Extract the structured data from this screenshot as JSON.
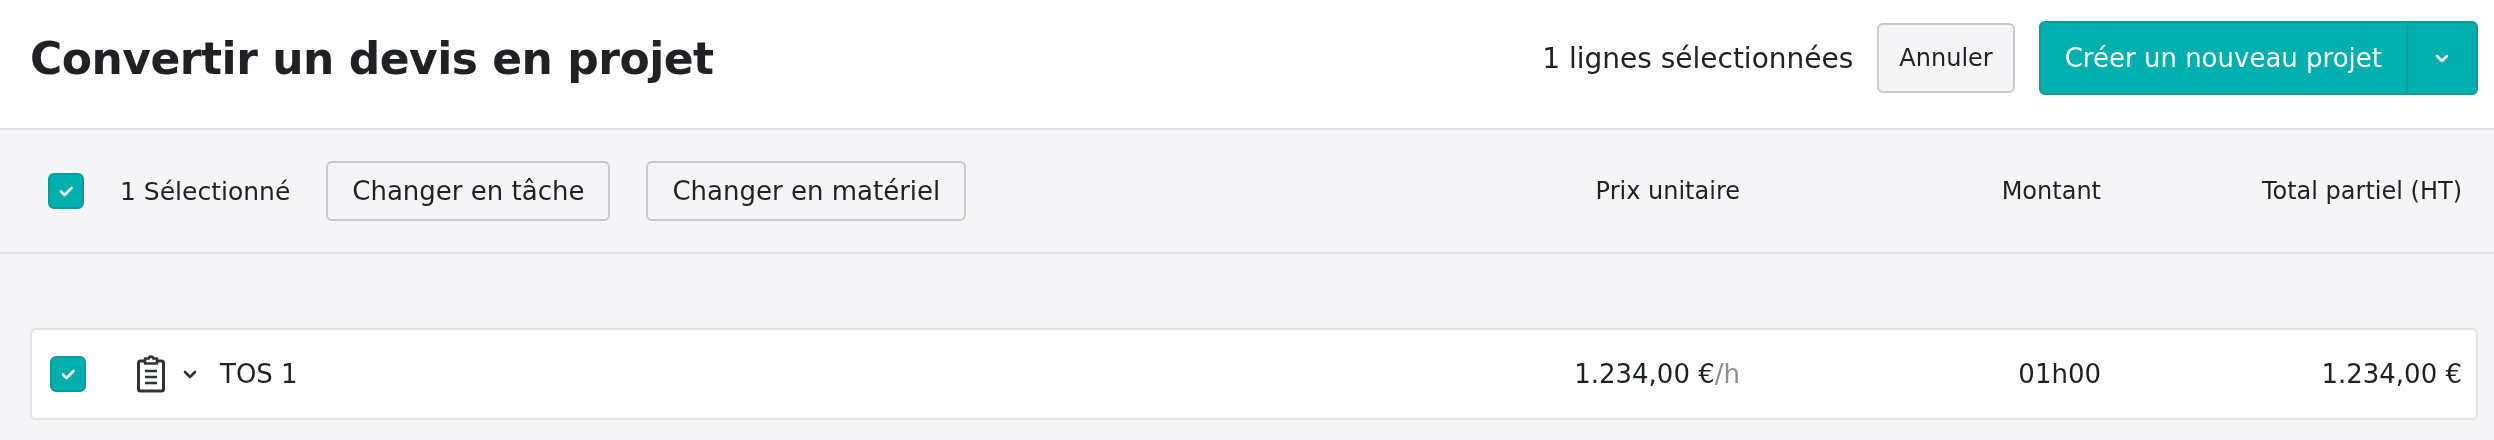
{
  "header": {
    "title": "Convertir un devis en projet",
    "selection_count": "1 lignes sélectionnées",
    "cancel_button": "Annuler",
    "primary_button": "Créer un nouveau projet"
  },
  "toolbar": {
    "checked": true,
    "selected_label": "1 Sélectionné",
    "actions": [
      "Changer en tâche",
      "Changer en matériel"
    ]
  },
  "columns": [
    "Prix unitaire",
    "Montant",
    "Total partiel (HT)"
  ],
  "rows": [
    {
      "checked": true,
      "kind": "task",
      "name": "TOS 1",
      "unit_price": "1.234,00 €",
      "unit": "/h",
      "amount": "01h00",
      "subtotal": "1.234,00 €"
    }
  ]
}
